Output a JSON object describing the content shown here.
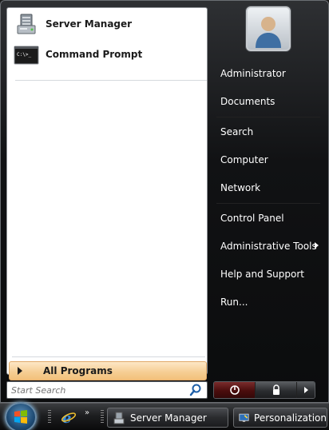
{
  "pinned": [
    {
      "label": "Server Manager",
      "icon": "server-manager-icon"
    },
    {
      "label": "Command Prompt",
      "icon": "command-prompt-icon"
    }
  ],
  "all_programs": {
    "label": "All Programs"
  },
  "search": {
    "placeholder": "Start Search",
    "value": ""
  },
  "user": {
    "avatar": "user-avatar-icon"
  },
  "right_items": [
    {
      "label": "Administrator"
    },
    {
      "label": "Documents"
    },
    {
      "label": "Search"
    },
    {
      "label": "Computer"
    },
    {
      "label": "Network"
    },
    {
      "label": "Control Panel"
    },
    {
      "label": "Administrative Tools",
      "has_submenu": true
    },
    {
      "label": "Help and Support"
    },
    {
      "label": "Run..."
    }
  ],
  "power": {
    "power_icon": "power-icon",
    "lock_icon": "lock-icon",
    "more_icon": "arrow-right-icon"
  },
  "taskbar": {
    "start_icon": "windows-start-orb",
    "quicklaunch": [
      "internet-explorer-icon"
    ],
    "buttons": [
      {
        "label": "Server Manager",
        "icon": "server-manager-icon"
      },
      {
        "label": "Personalization",
        "icon": "personalization-icon"
      }
    ]
  },
  "colors": {
    "menu_bg": "#111214",
    "left_pane_bg": "#ffffff",
    "all_programs_highlight": "#f6cf95",
    "power_button": "#4a0d0d",
    "text_light": "#ffffff"
  }
}
